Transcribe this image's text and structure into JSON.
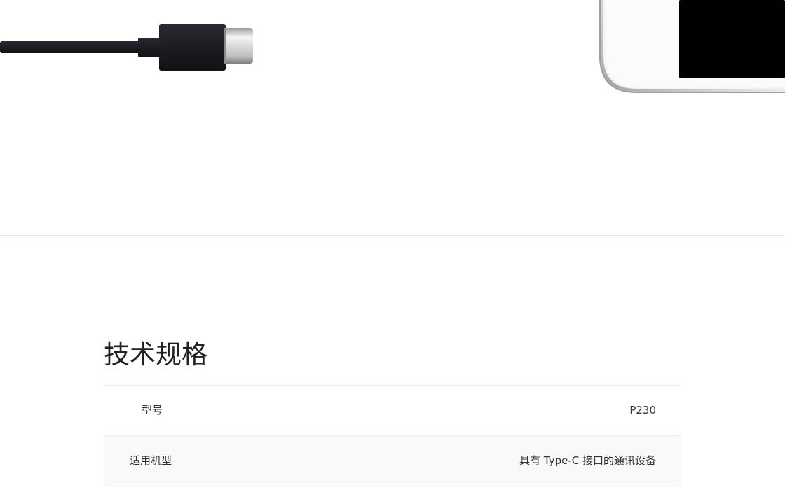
{
  "hero": {
    "cable_icon": "usb-type-c-cable",
    "phone_icon": "phone-corner"
  },
  "specs": {
    "title": "技术规格",
    "rows": [
      {
        "label": "型号",
        "value": "P230"
      },
      {
        "label": "适用机型",
        "value": "具有 Type-C 接口的通讯设备"
      }
    ]
  }
}
